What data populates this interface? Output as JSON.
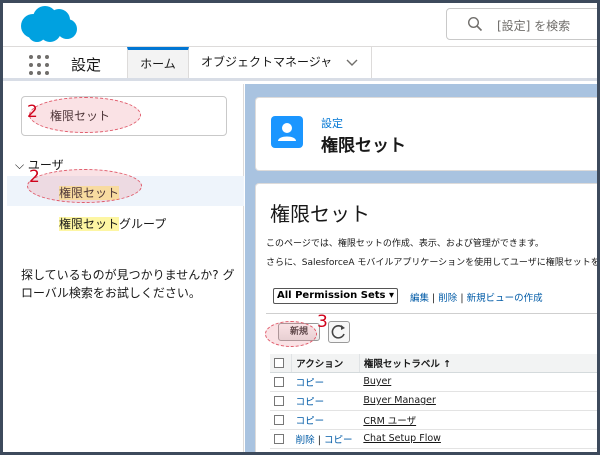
{
  "header": {
    "search_placeholder": "[設定] を検索",
    "brand_color": "#00a1e0"
  },
  "nav": {
    "app_name": "設定",
    "tabs": [
      {
        "label": "ホーム"
      },
      {
        "label": "オブジェクトマネージャ"
      }
    ]
  },
  "sidebar": {
    "quickfind_value": "権限セット",
    "tree_group": "ユーザ",
    "items": [
      {
        "label": "権限セット"
      },
      {
        "label_highlight": "権限セット",
        "label_rest": "グループ"
      }
    ],
    "help_text": "探しているものが見つかりませんか? グローバル検索をお試しください。"
  },
  "page_header": {
    "breadcrumb": "設定",
    "title": "権限セット"
  },
  "content": {
    "title": "権限セット",
    "description_1": "このページでは、権限セットの作成、表示、および管理ができます。",
    "description_2": "さらに、SalesforceA モバイルアプリケーションを使用してユーザに権限セットを",
    "view_select": "All Permission Sets",
    "view_links": {
      "edit": "編集",
      "delete": "削除",
      "new_view": "新規ビューの作成",
      "sep": "|"
    },
    "new_button": "新規",
    "table": {
      "headers": {
        "action": "アクション",
        "label": "権限セットラベル",
        "sort": "↑"
      },
      "rows": [
        {
          "action": "コピー",
          "label": "Buyer"
        },
        {
          "action": "コピー",
          "label": "Buyer Manager"
        },
        {
          "action": "コピー",
          "label": "CRM ユーザ"
        },
        {
          "action_delete": "削除",
          "action": "コピー",
          "label": "Chat Setup Flow"
        }
      ]
    }
  },
  "annotations": {
    "step_2a": "2",
    "step_2b": "2",
    "step_3": "3"
  }
}
